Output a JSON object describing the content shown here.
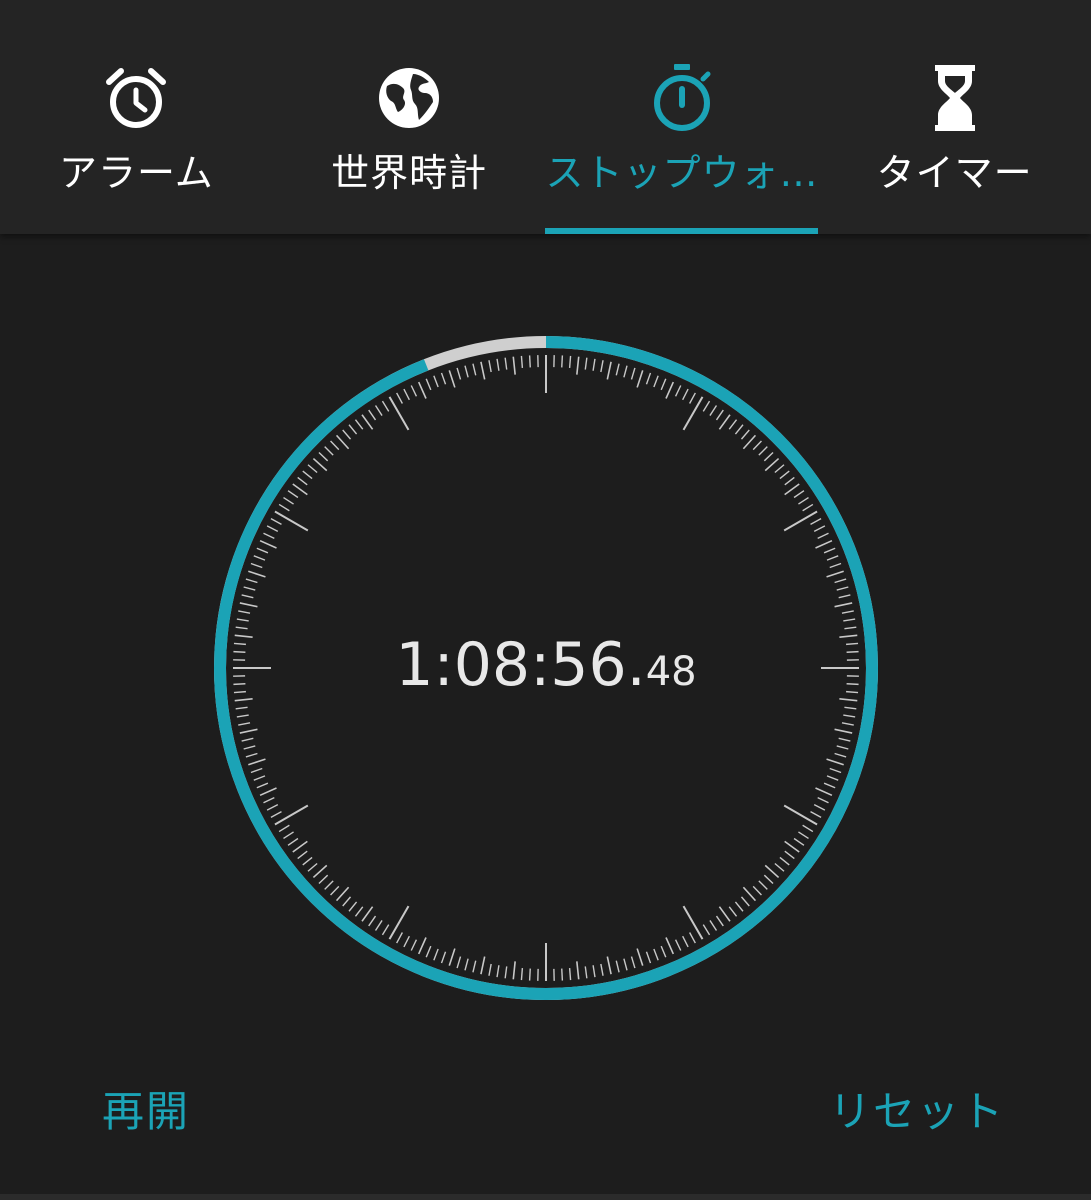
{
  "tabs": [
    {
      "label": "アラーム",
      "icon": "alarm-icon",
      "active": false
    },
    {
      "label": "世界時計",
      "icon": "globe-icon",
      "active": false
    },
    {
      "label": "ストップウォ…",
      "icon": "stopwatch-icon",
      "active": true
    },
    {
      "label": "タイマー",
      "icon": "hourglass-icon",
      "active": false
    }
  ],
  "stopwatch": {
    "time_main": "1:08:56",
    "time_sep": ".",
    "time_fraction": "48",
    "progress_fraction": 0.94
  },
  "actions": {
    "resume_label": "再開",
    "reset_label": "リセット"
  },
  "colors": {
    "accent": "#1ba3b6",
    "background": "#1d1d1d",
    "tabbar": "#242424",
    "ring_remaining": "#cfcfcf",
    "text": "#ffffff"
  }
}
